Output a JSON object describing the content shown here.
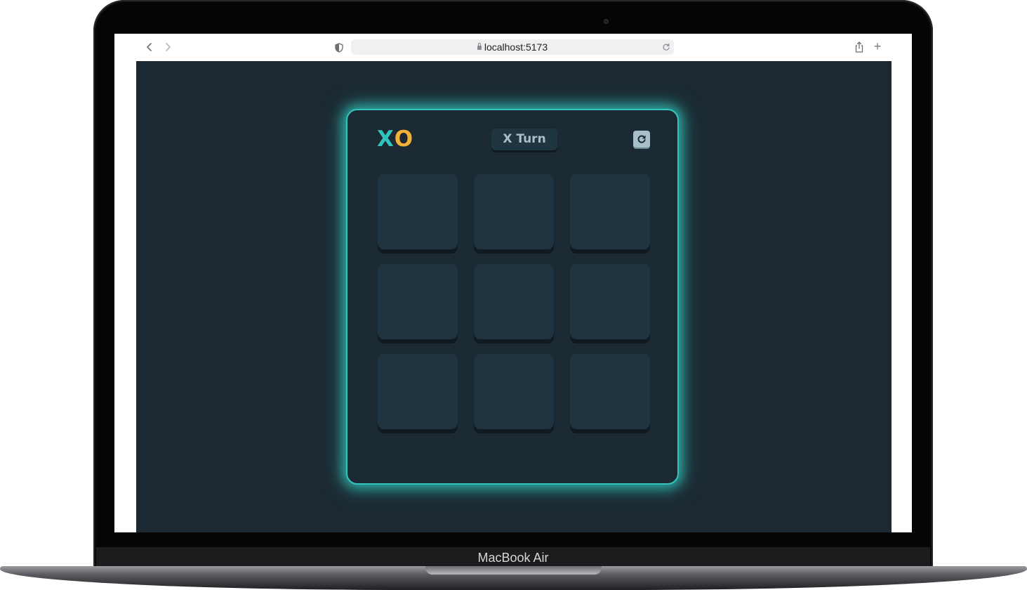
{
  "device": {
    "label": "MacBook Air"
  },
  "browser": {
    "url": "localhost:5173",
    "back_icon": "chevron-left-icon",
    "forward_icon": "chevron-right-icon",
    "privacy_icon": "shield-icon",
    "reload_icon": "reload-icon",
    "share_icon": "share-icon",
    "new_tab_label": "+"
  },
  "game": {
    "logo_x": "X",
    "logo_o": "O",
    "turn_label": "X Turn",
    "reset_icon": "restart-icon",
    "cells": [
      "",
      "",
      "",
      "",
      "",
      "",
      "",
      "",
      ""
    ],
    "colors": {
      "x": "#31c4bc",
      "o": "#f2b237",
      "background": "#1c2932",
      "tile": "#1f3340",
      "glow": "#33c4bb",
      "badge_text": "#a8bec9"
    }
  }
}
